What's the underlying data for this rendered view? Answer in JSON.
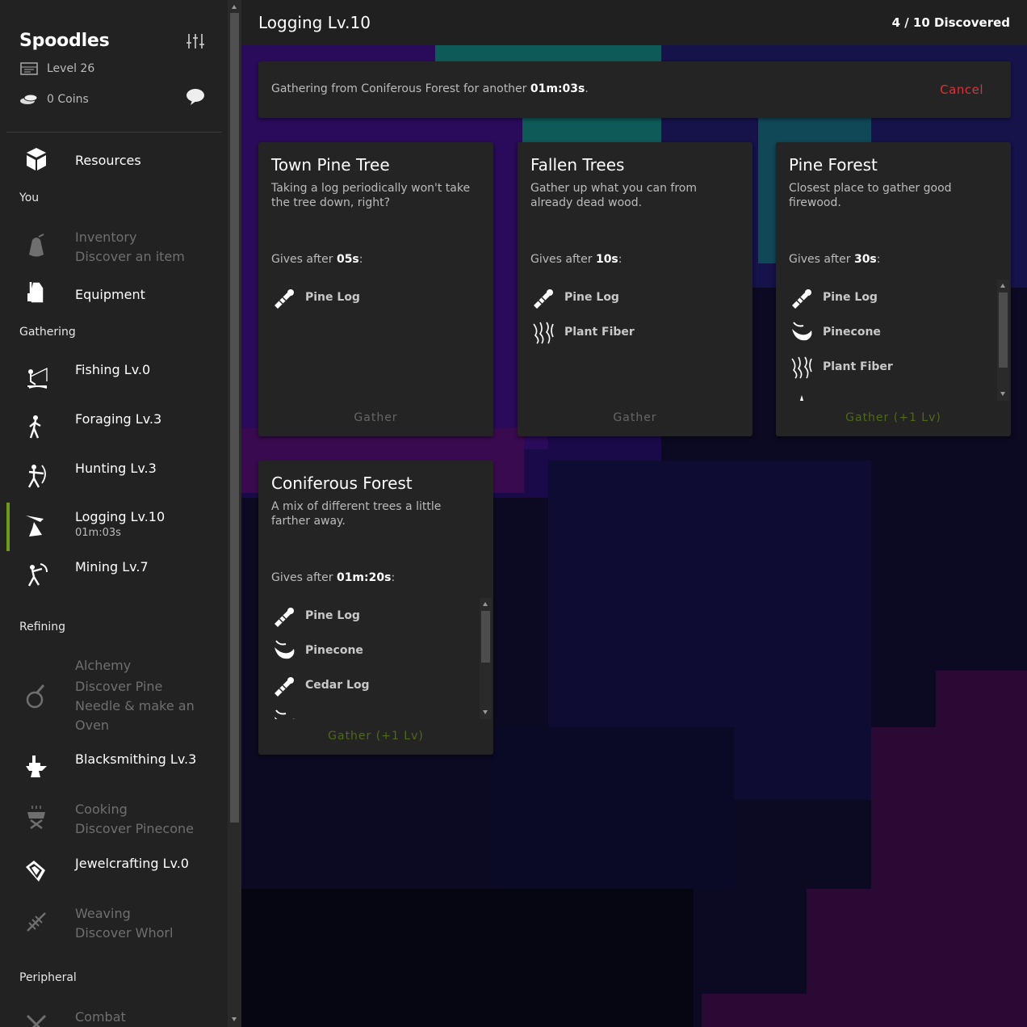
{
  "profile": {
    "name": "Spoodles",
    "level": "Level 26",
    "coins": "0 Coins"
  },
  "nav": {
    "resources": "Resources",
    "you_header": "You",
    "inventory": {
      "label": "Inventory",
      "sub": "Discover an item"
    },
    "equipment": "Equipment",
    "gathering_header": "Gathering",
    "fishing": "Fishing Lv.0",
    "foraging": "Foraging Lv.3",
    "hunting": "Hunting Lv.3",
    "logging": {
      "label": "Logging Lv.10",
      "sub": "01m:03s"
    },
    "mining": "Mining Lv.7",
    "refining_header": "Refining",
    "alchemy": {
      "label": "Alchemy",
      "sub": "Discover Pine Needle & make an Oven"
    },
    "blacksmithing": "Blacksmithing Lv.3",
    "cooking": {
      "label": "Cooking",
      "sub": "Discover Pinecone"
    },
    "jewelcrafting": "Jewelcrafting Lv.0",
    "weaving": {
      "label": "Weaving",
      "sub": "Discover Whorl"
    },
    "peripheral_header": "Peripheral",
    "combat": "Combat"
  },
  "header": {
    "title": "Logging Lv.10",
    "discovered": "4 / 10 Discovered"
  },
  "banner": {
    "text_prefix": "Gathering from Coniferous Forest for another ",
    "time": "01m:03s",
    "text_suffix": ".",
    "cancel": "Cancel"
  },
  "cards": [
    {
      "title": "Town Pine Tree",
      "desc": "Taking a log periodically won't take the tree down, right?",
      "gives_prefix": "Gives after ",
      "time": "05s",
      "gives_suffix": ":",
      "items": [
        {
          "name": "Pine Log",
          "icon": "log-icon"
        }
      ],
      "gather": "Gather"
    },
    {
      "title": "Fallen Trees",
      "desc": "Gather up what you can from already dead wood.",
      "gives_prefix": "Gives after ",
      "time": "10s",
      "gives_suffix": ":",
      "items": [
        {
          "name": "Pine Log",
          "icon": "log-icon"
        },
        {
          "name": "Plant Fiber",
          "icon": "fiber-icon"
        }
      ],
      "gather": "Gather"
    },
    {
      "title": "Pine Forest",
      "desc": "Closest place to gather good firewood.",
      "gives_prefix": "Gives after ",
      "time": "30s",
      "gives_suffix": ":",
      "items": [
        {
          "name": "Pine Log",
          "icon": "log-icon"
        },
        {
          "name": "Pinecone",
          "icon": "seed-icon"
        },
        {
          "name": "Plant Fiber",
          "icon": "fiber-icon"
        },
        {
          "name": "",
          "icon": "needle-icon"
        }
      ],
      "gather": "Gather (+1 Lv)"
    },
    {
      "title": "Coniferous Forest",
      "desc": "A mix of different trees a little farther away.",
      "gives_prefix": "Gives after ",
      "time": "01m:20s",
      "gives_suffix": ":",
      "items": [
        {
          "name": "Pine Log",
          "icon": "log-icon"
        },
        {
          "name": "Pinecone",
          "icon": "seed-icon"
        },
        {
          "name": "Cedar Log",
          "icon": "log-icon"
        },
        {
          "name": "",
          "icon": "seed-icon"
        }
      ],
      "gather": "Gather (+1 Lv)"
    }
  ],
  "colors": {
    "accent_active": "#6a9a1e",
    "cancel": "#e0303a",
    "gather_level": "#4d6a16"
  }
}
